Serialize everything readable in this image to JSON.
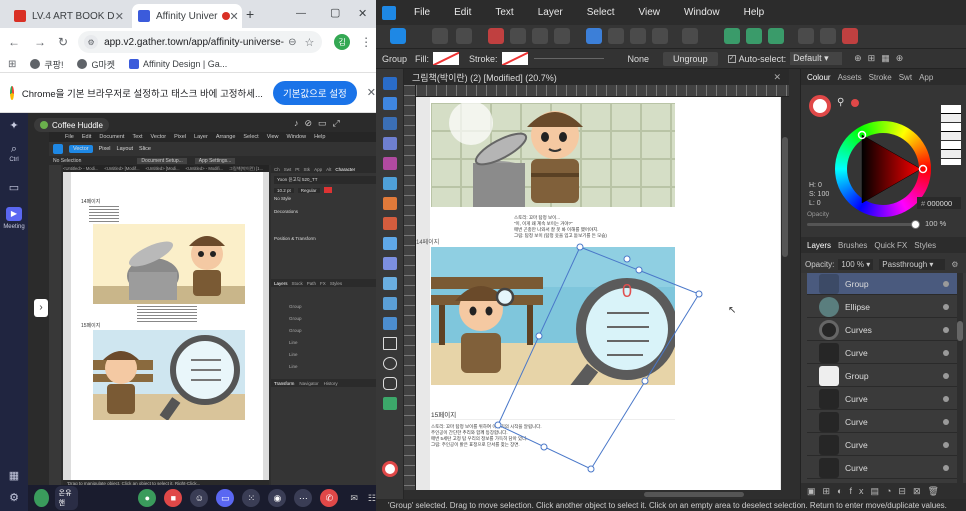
{
  "chrome": {
    "tabs": [
      {
        "label": "LV.4 ART BOOK D",
        "active": false
      },
      {
        "label": "Affinity Univer",
        "active": true
      }
    ],
    "new_tab": "+",
    "window_controls": {
      "minimize": "—",
      "maximize": "▢",
      "close": "✕"
    },
    "url": "app.v2.gather.town/app/affinity-universe-3...",
    "bookmarks": [
      "쿠팡!",
      "G마켓",
      "Affinity Design | Ga..."
    ],
    "infobar_text": "Chrome을 기본 브라우저로 설정하고 태스크 바에 고정하세...",
    "infobar_button": "기본값으로 설정",
    "profile_initial": "김"
  },
  "gather": {
    "side_labels": {
      "ctrl": "Ctrl",
      "meeting": "Meeting"
    },
    "stage_title": "Coffee Huddle",
    "mini_menu": [
      "File",
      "Edit",
      "Document",
      "Text",
      "Vector",
      "Pixel",
      "Layer",
      "Arrange",
      "Select",
      "View",
      "Window",
      "Help"
    ],
    "mini_tabs": [
      "Vector",
      "Pixel",
      "Layout",
      "Slice"
    ],
    "mini_context": [
      "No Selection",
      "Document Setup...",
      "App Settings..."
    ],
    "mini_doc_tabs": [
      "<Untitled> - Modi...",
      "<Untitled> [Modif...",
      "<Untitled> [Modi...",
      "<Untitled> - Modifi...",
      "그림책(박이란) [1..."
    ],
    "mini_page_caption_1": "14페이지",
    "mini_page_caption_2": "15페이지",
    "mini_panel_tabs": [
      "Ch",
      "Swt",
      "Pt",
      "Stk",
      "App",
      "Alt",
      "Character"
    ],
    "mini_panel_font": "Yoon 윤고딕 520_TT",
    "mini_panel_size": "10.2 pt",
    "mini_panel_style": "Regular",
    "mini_panel_nostyle": "No Style",
    "mini_panel_decorations": "Decorations",
    "mini_panel_position": "Position & Transform",
    "mini_layer_tabs": [
      "Layers",
      "Stock",
      "Path",
      "FX",
      "Styles"
    ],
    "mini_layer_rows": [
      "Group",
      "Group",
      "Group",
      "Line",
      "Line",
      "Line"
    ],
    "mini_transform_tabs": [
      "Transform",
      "Navigator",
      "History"
    ],
    "mini_status": "'Drag to manipulate object. Click an object to select it. Right-Click...",
    "bottom_name": "온유핸"
  },
  "affinity": {
    "menu": [
      "File",
      "Edit",
      "Text",
      "Layer",
      "Select",
      "View",
      "Window",
      "Help"
    ],
    "context": {
      "group": "Group",
      "fill": "Fill:",
      "stroke": "Stroke:",
      "stroke_none": "None",
      "ungroup": "Ungroup",
      "auto_select": "Auto-select:",
      "auto_select_value": "Default"
    },
    "doc_title": "그림책(박이란) (2) [Modified] (20.7%)",
    "page": {
      "text_block_1": [
        "스토리: 꼬마 탐정 보이...",
        "“이, 이게 왜 계속 보이는 거야?”",
        "매번 곤충만 나와서 잘 못 봐 이해를 했어야지.",
        "그림: 탐정 보이 (탐정 옷을 입고 돋보기를 든 모습)"
      ],
      "caption_14": "14페이지",
      "caption_15": "15페이지",
      "text_block_2": [
        "스토리: 꼬마 탐정 보이를 위하여 이야기의 시작을 알립니다.",
        "주인공이 간단한 추리와 함께 등장합니다.",
        "매번 5세탄 고정 탐 우리의 정보를 가득히 담아 있다.",
        "그림: 주인공이 밝은 표정으로 단서를 찾는 장면."
      ]
    },
    "panel_tabs_top": [
      "Colour",
      "Assets",
      "Stroke",
      "Swt",
      "App"
    ],
    "hsl": {
      "h": "H: 0",
      "s": "S: 100",
      "l": "L: 0"
    },
    "hex": "000000",
    "opacity_label": "Opacity",
    "opacity_value": "100 %",
    "layers_tabs": [
      "Layers",
      "Brushes",
      "Quick FX",
      "Styles"
    ],
    "layers_opacity_label": "Opacity:",
    "layers_opacity_value": "100 %",
    "blend_mode": "Passthrough",
    "layers": [
      {
        "name": "Group",
        "selected": true
      },
      {
        "name": "Ellipse",
        "selected": false
      },
      {
        "name": "Curves",
        "selected": false
      },
      {
        "name": "Curve",
        "selected": false
      },
      {
        "name": "Group",
        "selected": false
      },
      {
        "name": "Curve",
        "selected": false
      },
      {
        "name": "Curve",
        "selected": false
      },
      {
        "name": "Curve",
        "selected": false
      },
      {
        "name": "Curve",
        "selected": false
      }
    ],
    "status": "'Group' selected. Drag to move selection. Click another object to select it. Click on an empty area to deselect selection. Return to enter move/duplicate values.",
    "colors": {
      "accent": "#3d7fe0",
      "selection": "#4a78c9",
      "wheel_ring": "#f04050"
    }
  }
}
